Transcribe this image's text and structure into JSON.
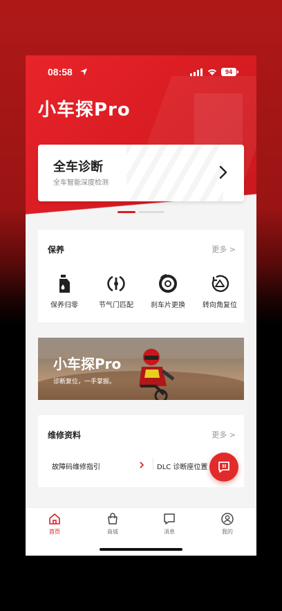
{
  "status": {
    "time": "08:58",
    "battery": "94"
  },
  "app": {
    "logo": "小车探Pro"
  },
  "diagnosis": {
    "title": "全车诊断",
    "subtitle": "全车智能深度检测"
  },
  "maintenance": {
    "title": "保养",
    "more": "更多 >",
    "tools": [
      {
        "label": "保养归零",
        "icon": "oil-bottle-icon"
      },
      {
        "label": "节气门匹配",
        "icon": "throttle-icon"
      },
      {
        "label": "刹车片更换",
        "icon": "brake-disc-icon"
      },
      {
        "label": "转向角复位",
        "icon": "steering-reset-icon"
      }
    ]
  },
  "banner": {
    "logo": "小车探Pro",
    "tagline": "诊断复位，一手掌握。"
  },
  "repair": {
    "title": "维修资料",
    "more": "更多 >",
    "items": [
      {
        "label": "故障码维修指引"
      },
      {
        "label": "DLC 诊断座位置"
      }
    ]
  },
  "tabbar": {
    "tabs": [
      {
        "label": "首页",
        "icon": "home-icon",
        "active": true
      },
      {
        "label": "商城",
        "icon": "shopping-bag-icon",
        "active": false
      },
      {
        "label": "消息",
        "icon": "message-icon",
        "active": false
      },
      {
        "label": "我的",
        "icon": "profile-icon",
        "active": false
      }
    ]
  },
  "colors": {
    "brand_red": "#d71c22",
    "fab_red": "#e22a2a",
    "background": "#f4f4f4"
  }
}
